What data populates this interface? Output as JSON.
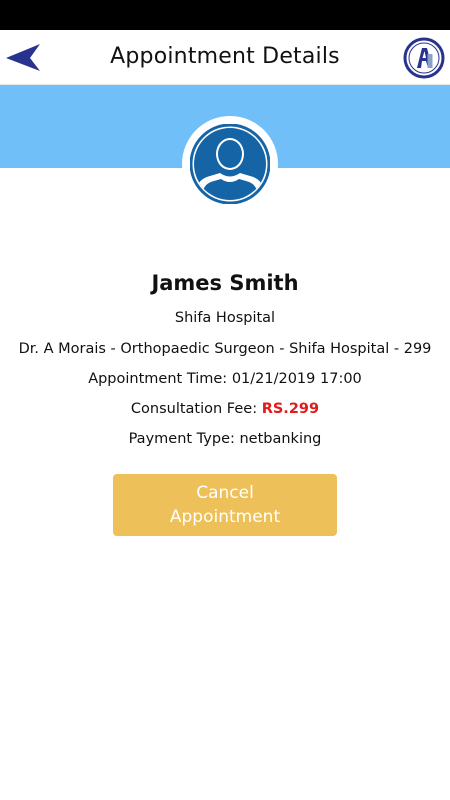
{
  "header": {
    "title": "Appointment Details",
    "back_icon": "back-arrow-icon",
    "logo_icon": "app-logo-icon",
    "logo_text": "A"
  },
  "colors": {
    "banner": "#71bff8",
    "avatar": "#1565a6",
    "button": "#eec05a",
    "fee": "#e01b1b",
    "back_arrow": "#28338f"
  },
  "appointment": {
    "patient_name": "James Smith",
    "hospital": "Shifa Hospital",
    "doctor_line": "Dr. A Morais - Orthopaedic Surgeon - Shifa Hospital - 299",
    "time_label": "Appointment Time:",
    "time_value": "01/21/2019 17:00",
    "fee_label": "Consultation Fee:",
    "fee_value": "RS.299",
    "payment_label": "Payment Type:",
    "payment_value": "netbanking"
  },
  "actions": {
    "cancel_line1": "Cancel",
    "cancel_line2": "Appointment"
  }
}
